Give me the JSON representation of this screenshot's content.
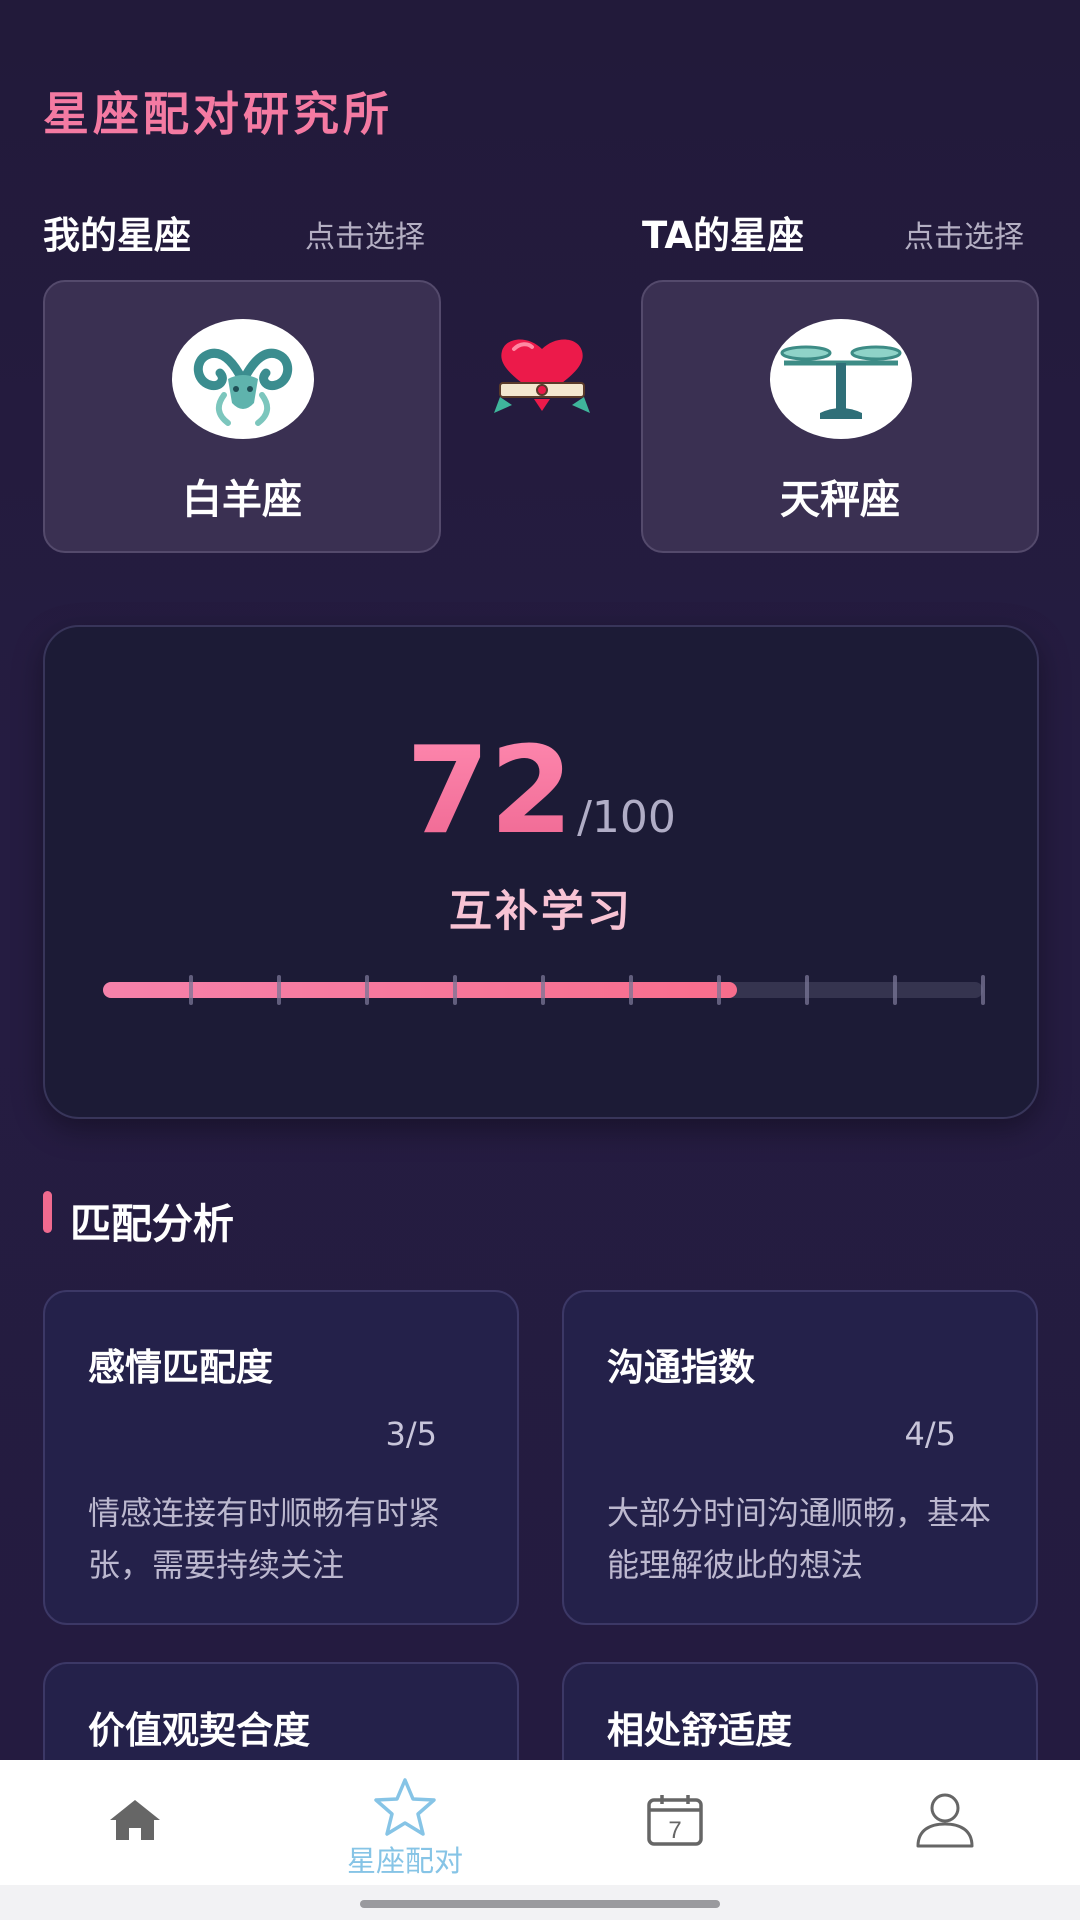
{
  "app_title": "星座配对研究所",
  "my_sign": {
    "header": "我的星座",
    "hint": "点击选择",
    "name": "白羊座",
    "icon": "aries-icon"
  },
  "their_sign": {
    "header": "TA的星座",
    "hint": "点击选择",
    "name": "天秤座",
    "icon": "libra-icon"
  },
  "result": {
    "score": "72",
    "total": "/100",
    "score_value": 72,
    "score_max": 100,
    "label": "互补学习"
  },
  "analysis": {
    "title": "匹配分析",
    "cards": [
      {
        "title": "感情匹配度",
        "score": "3/5",
        "desc": "情感连接有时顺畅有时紧张，需要持续关注"
      },
      {
        "title": "沟通指数",
        "score": "4/5",
        "desc": "大部分时间沟通顺畅，基本能理解彼此的想法"
      },
      {
        "title": "价值观契合度"
      },
      {
        "title": "相处舒适度"
      }
    ]
  },
  "tabbar": {
    "items": [
      {
        "icon": "home-icon",
        "label": ""
      },
      {
        "icon": "star-icon",
        "label": "星座配对",
        "active": true
      },
      {
        "icon": "calendar-icon",
        "label": ""
      },
      {
        "icon": "user-icon",
        "label": ""
      }
    ],
    "calendar_day": "7"
  },
  "colors": {
    "accent": "#f06f9b",
    "background": "#231b3e",
    "active_tab": "#86c4e6"
  }
}
